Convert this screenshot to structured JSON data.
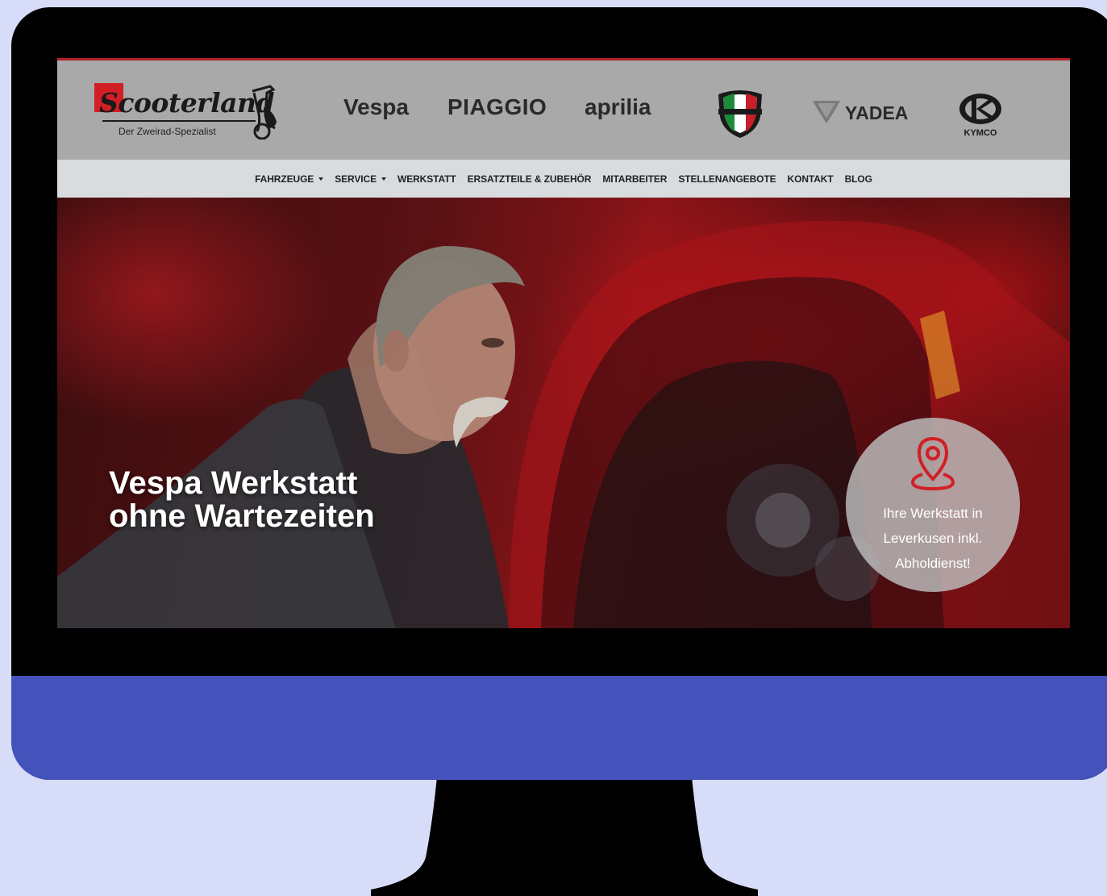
{
  "logo": {
    "wordmark": "Scooterland",
    "tagline": "Der Zweirad-Spezialist"
  },
  "brands": {
    "vespa": "Vespa",
    "piaggio": "PIAGGIO",
    "aprilia": "aprilia",
    "yadea": "YADEA",
    "kymco": "KYMCO"
  },
  "nav": {
    "items": [
      {
        "label": "FAHRZEUGE",
        "dropdown": true
      },
      {
        "label": "SERVICE",
        "dropdown": true
      },
      {
        "label": "WERKSTATT",
        "dropdown": false
      },
      {
        "label": "ERSATZTEILE & ZUBEHÖR",
        "dropdown": false
      },
      {
        "label": "MITARBEITER",
        "dropdown": false
      },
      {
        "label": "STELLENANGEBOTE",
        "dropdown": false
      },
      {
        "label": "KONTAKT",
        "dropdown": false
      },
      {
        "label": "BLOG",
        "dropdown": false
      }
    ]
  },
  "hero": {
    "title_line1": "Vespa Werkstatt",
    "title_line2": "ohne Wartezeiten",
    "badge_line1": "Ihre Werkstatt in",
    "badge_line2": "Leverkusen inkl.",
    "badge_line3": "Abholdienst!",
    "badge_icon": "location-pin-icon"
  },
  "colors": {
    "accent_red": "#d11f26",
    "chin_blue": "#4452bb",
    "background": "#d7dcf8"
  }
}
